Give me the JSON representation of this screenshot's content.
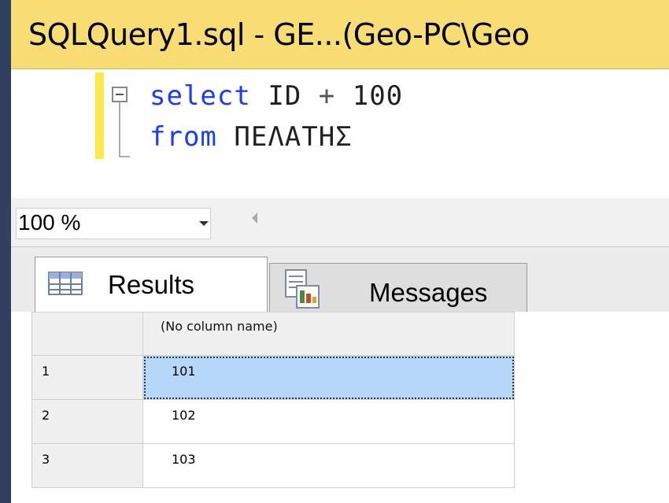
{
  "window": {
    "tab_title": "SQLQuery1.sql - GE...(Geo-PC\\Geo"
  },
  "editor": {
    "line1": {
      "kw": "select",
      "ident": "ID",
      "op": "+",
      "num": "100"
    },
    "line2": {
      "kw": "from",
      "ident": "ΠΕΛΑΤΗΣ"
    }
  },
  "status": {
    "zoom_value": "100 %"
  },
  "tabs": {
    "results_label": "Results",
    "messages_label": "Messages"
  },
  "grid": {
    "column_header": "(No column name)",
    "rows": [
      {
        "num": "1",
        "value": "101",
        "selected": true
      },
      {
        "num": "2",
        "value": "102",
        "selected": false
      },
      {
        "num": "3",
        "value": "103",
        "selected": false
      }
    ]
  },
  "colors": {
    "tab_background": "#f8dc74",
    "keyword": "#1a3cf5",
    "selection": "#b4d7fa",
    "change_bar": "#ffe84a"
  },
  "icons": [
    "grid-icon",
    "messages-icon",
    "collapse-icon",
    "dropdown-arrow-icon",
    "scroll-left-icon"
  ]
}
